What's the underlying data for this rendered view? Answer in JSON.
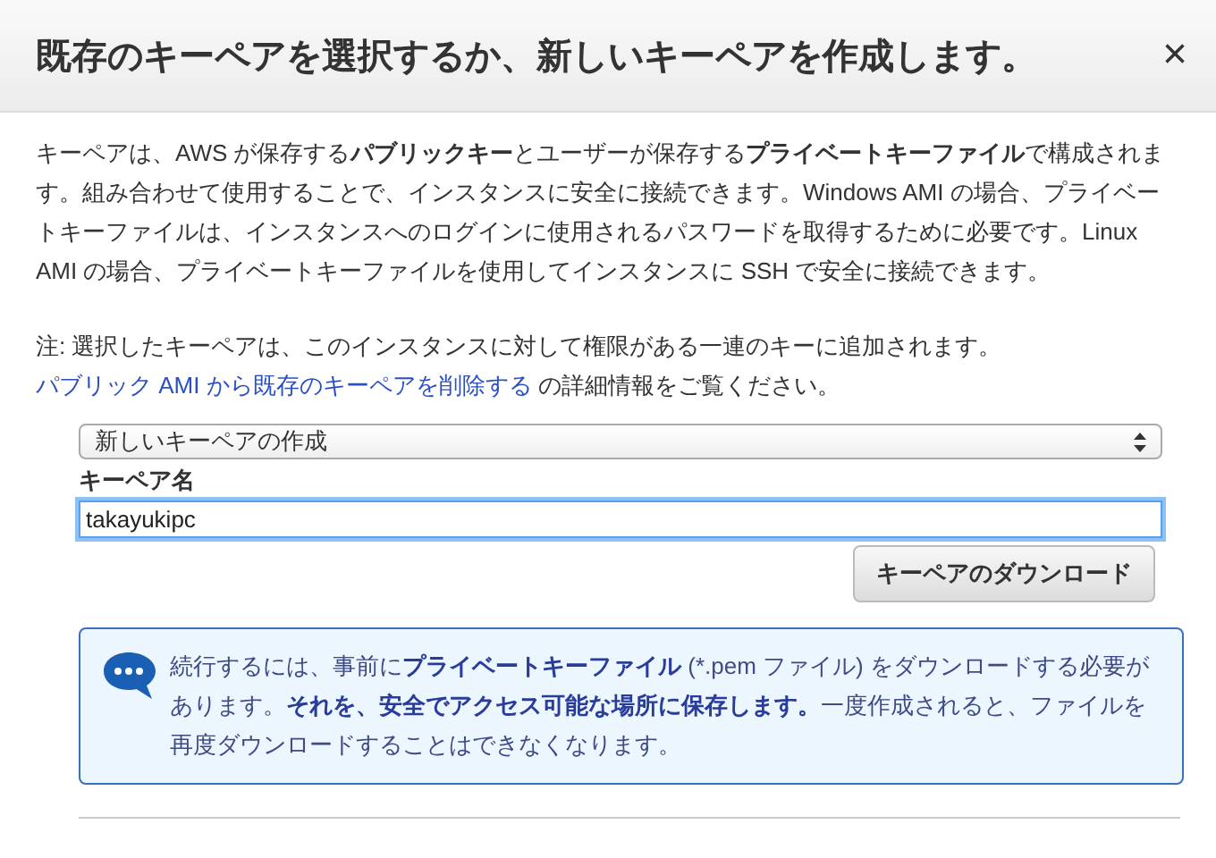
{
  "dialog": {
    "title": "既存のキーペアを選択するか、新しいキーペアを作成します。",
    "close": "×"
  },
  "description": "キーペアは、AWS が保存する**パブリックキー**とユーザーが保存する**プライベートキーファイル**で構成されます。組み合わせて使用することで、インスタンスに安全に接続できます。Windows AMI の場合、プライベートキーファイルは、インスタンスへのログインに使用されるパスワードを取得するために必要です。Linux AMI の場合、プライベートキーファイルを使用してインスタンスに SSH で安全に接続できます。",
  "note": {
    "before": "注: 選択したキーペアは、このインスタンスに対して権限がある一連のキーに追加されます。",
    "link": "パブリック AMI から既存のキーペアを削除する",
    "after": " の詳細情報をご覧ください。"
  },
  "select": {
    "value": "新しいキーペアの作成"
  },
  "key_name": {
    "label": "キーペア名",
    "value": "takayukipc",
    "focused": true
  },
  "download_button": "キーペアのダウンロード",
  "info": {
    "text": "続行するには、事前に**プライベートキーファイル** (*.pem ファイル) をダウンロードする必要があります。**それを、安全でアクセス可能な場所に保存します。**一度作成されると、ファイルを再度ダウンロードすることはできなくなります。"
  }
}
